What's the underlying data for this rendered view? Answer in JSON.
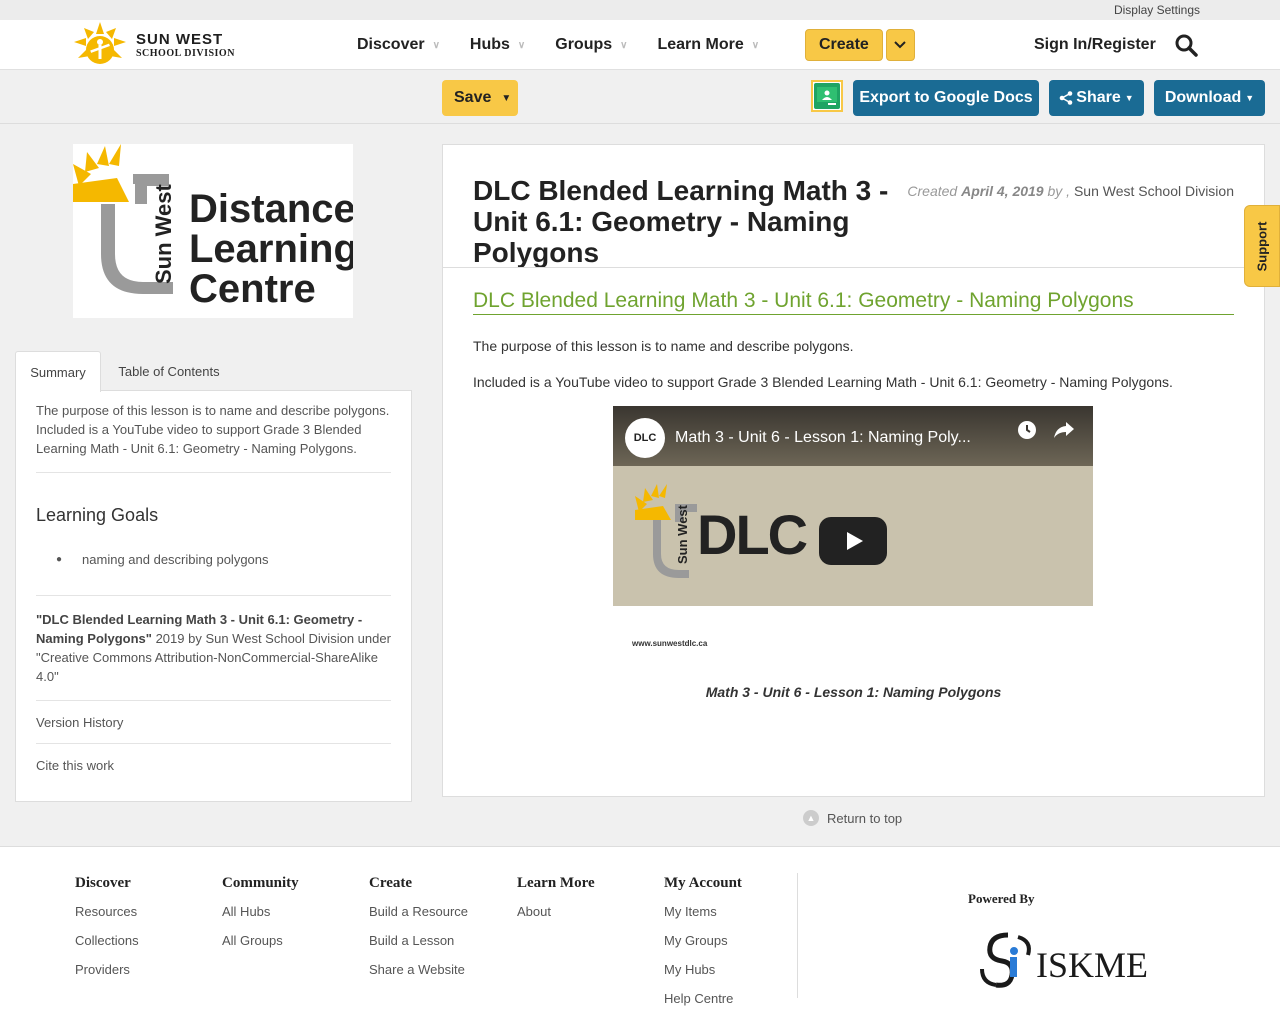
{
  "utility": {
    "display_settings": "Display Settings"
  },
  "brand": {
    "line1": "SUN WEST",
    "line2": "SCHOOL DIVISION"
  },
  "nav": {
    "items": [
      {
        "label": "Discover"
      },
      {
        "label": "Hubs"
      },
      {
        "label": "Groups"
      },
      {
        "label": "Learn More"
      }
    ],
    "create_label": "Create",
    "signin_label": "Sign In/Register"
  },
  "toolbar": {
    "save_label": "Save",
    "export_label": "Export to Google Docs",
    "share_label": "Share",
    "download_label": "Download"
  },
  "dlc_logo": {
    "line1": "Distance",
    "line2": "Learning",
    "line3": "Centre",
    "vertical": "Sun West"
  },
  "sidebar": {
    "tabs": [
      {
        "label": "Summary"
      },
      {
        "label": "Table of Contents"
      }
    ],
    "summary": "The purpose of this lesson is to name and describe polygons. Included is a YouTube video to support Grade 3 Blended Learning Math - Unit 6.1: Geometry - Naming Polygons.",
    "learning_goals_title": "Learning Goals",
    "learning_goals": [
      "naming and describing polygons"
    ],
    "license_title": "\"DLC Blended Learning Math 3 - Unit 6.1: Geometry - Naming Polygons\"",
    "license_rest": " 2019 by Sun West School Division under \"Creative Commons Attribution-NonCommercial-ShareAlike 4.0\"",
    "version_history": "Version History",
    "cite": "Cite this work"
  },
  "content": {
    "title": "DLC Blended Learning Math 3 - Unit 6.1: Geometry - Naming Polygons",
    "created_prefix": "Created",
    "created_date": "April 4, 2019",
    "created_by": "by ,",
    "author": "Sun West School Division",
    "section_title": "DLC Blended Learning Math 3 - Unit 6.1: Geometry - Naming Polygons",
    "para1": "The purpose of this lesson is to name and describe polygons.",
    "para2": "Included is a YouTube video to support Grade 3 Blended Learning Math - Unit 6.1: Geometry - Naming Polygons.",
    "video": {
      "channel": "DLC",
      "title": "Math 3 - Unit 6 - Lesson 1: Naming Poly...",
      "brand_text": "DLC",
      "vertical_text": "Sun West",
      "url": "www.sunwestdlc.ca"
    },
    "caption": "Math 3 - Unit 6 - Lesson 1: Naming Polygons"
  },
  "support_label": "Support",
  "return_top": "Return to top",
  "footer": {
    "columns": [
      {
        "title": "Discover",
        "links": [
          "Resources",
          "Collections",
          "Providers"
        ]
      },
      {
        "title": "Community",
        "links": [
          "All Hubs",
          "All Groups"
        ]
      },
      {
        "title": "Create",
        "links": [
          "Build a Resource",
          "Build a Lesson",
          "Share a Website"
        ]
      },
      {
        "title": "Learn More",
        "links": [
          "About"
        ]
      },
      {
        "title": "My Account",
        "links": [
          "My Items",
          "My Groups",
          "My Hubs",
          "Help Centre"
        ]
      }
    ],
    "powered_by": "Powered By",
    "iskme": "ISKME"
  },
  "colors": {
    "accent_yellow": "#f8c846",
    "button_blue": "#1a6b94",
    "link_green": "#6fa32f"
  }
}
